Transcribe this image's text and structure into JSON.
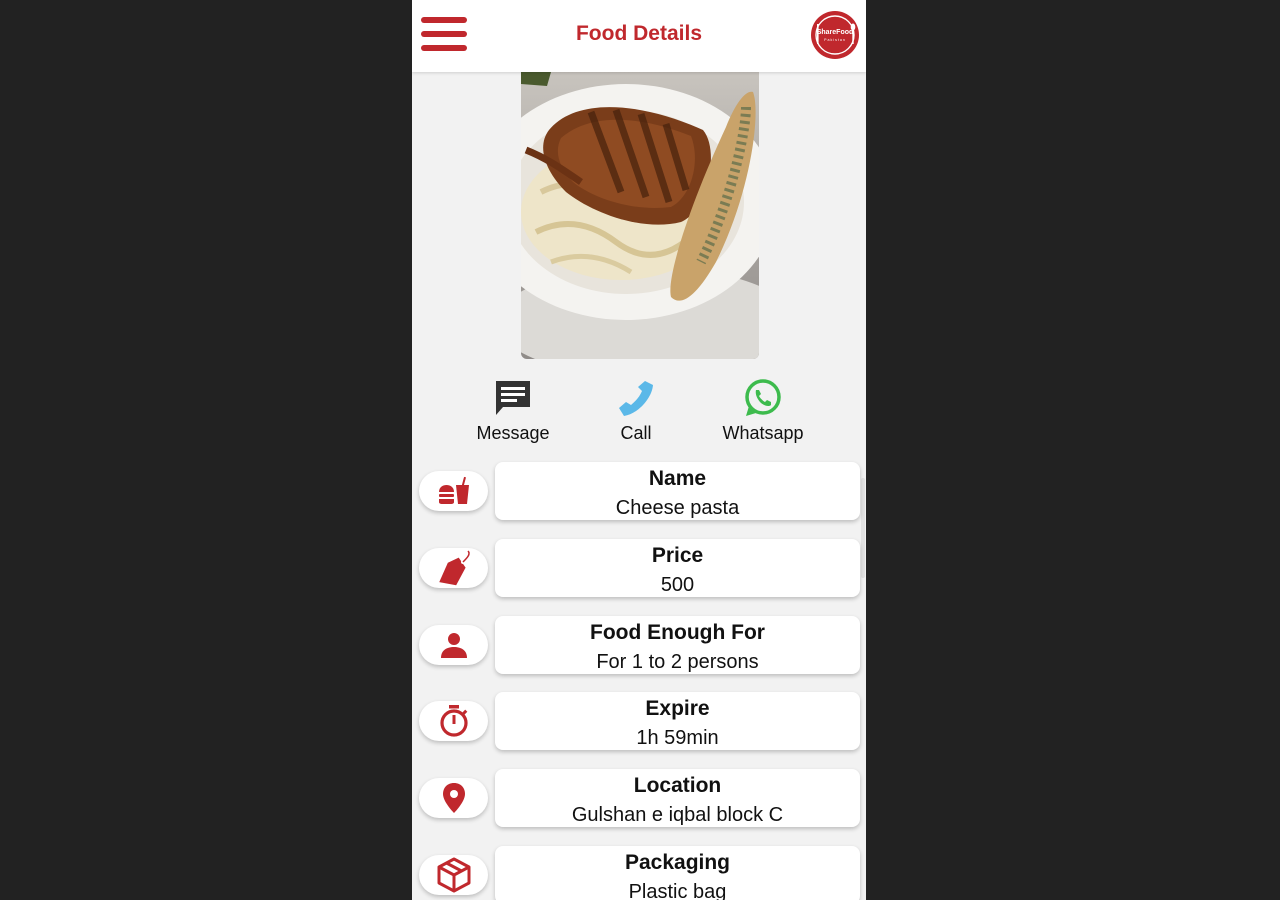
{
  "header": {
    "title": "Food Details",
    "logo_text": "ShareFood",
    "logo_subtext": "Pakistan"
  },
  "colors": {
    "accent": "#c0282d",
    "call": "#5bb8e8",
    "whatsapp": "#3dbb4d",
    "message_icon": "#333333"
  },
  "food_image": {
    "icon": "food-photo"
  },
  "actions": [
    {
      "label": "Message",
      "icon": "message-icon"
    },
    {
      "label": "Call",
      "icon": "phone-icon"
    },
    {
      "label": "Whatsapp",
      "icon": "whatsapp-icon"
    }
  ],
  "details": [
    {
      "key": "Name",
      "value": "Cheese pasta",
      "icon": "fastfood-icon"
    },
    {
      "key": "Price",
      "value": "500",
      "icon": "price-tag-icon"
    },
    {
      "key": "Food Enough For",
      "value": "For 1 to 2 persons",
      "icon": "person-icon"
    },
    {
      "key": "Expire",
      "value": "1h 59min",
      "icon": "timer-icon"
    },
    {
      "key": "Location",
      "value": "Gulshan e iqbal block C",
      "icon": "location-pin-icon"
    },
    {
      "key": "Packaging",
      "value": "Plastic bag",
      "icon": "box-icon"
    }
  ]
}
